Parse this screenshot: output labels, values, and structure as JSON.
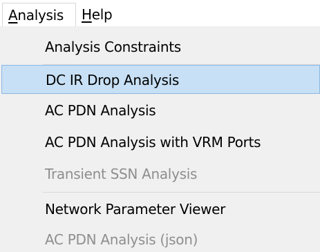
{
  "menubar": {
    "items": [
      {
        "label_underlined": "A",
        "label_rest": "nalysis"
      },
      {
        "label_underlined": "H",
        "label_rest": "elp"
      }
    ]
  },
  "menu": {
    "items": [
      {
        "label": "Analysis Constraints",
        "state": "normal"
      },
      {
        "label": "DC IR Drop Analysis",
        "state": "selected"
      },
      {
        "label": "AC PDN Analysis",
        "state": "normal"
      },
      {
        "label": "AC PDN Analysis with VRM Ports",
        "state": "normal"
      },
      {
        "label": "Transient SSN Analysis",
        "state": "disabled"
      },
      {
        "label": "Network Parameter Viewer",
        "state": "normal"
      },
      {
        "label": "AC PDN Analysis (json)",
        "state": "disabled"
      }
    ]
  },
  "colors": {
    "selected_bg": "#c8e0f5",
    "selected_border": "#8bb7e1",
    "menu_bg": "#f0f0f0",
    "disabled_text": "#8e8e8e"
  }
}
